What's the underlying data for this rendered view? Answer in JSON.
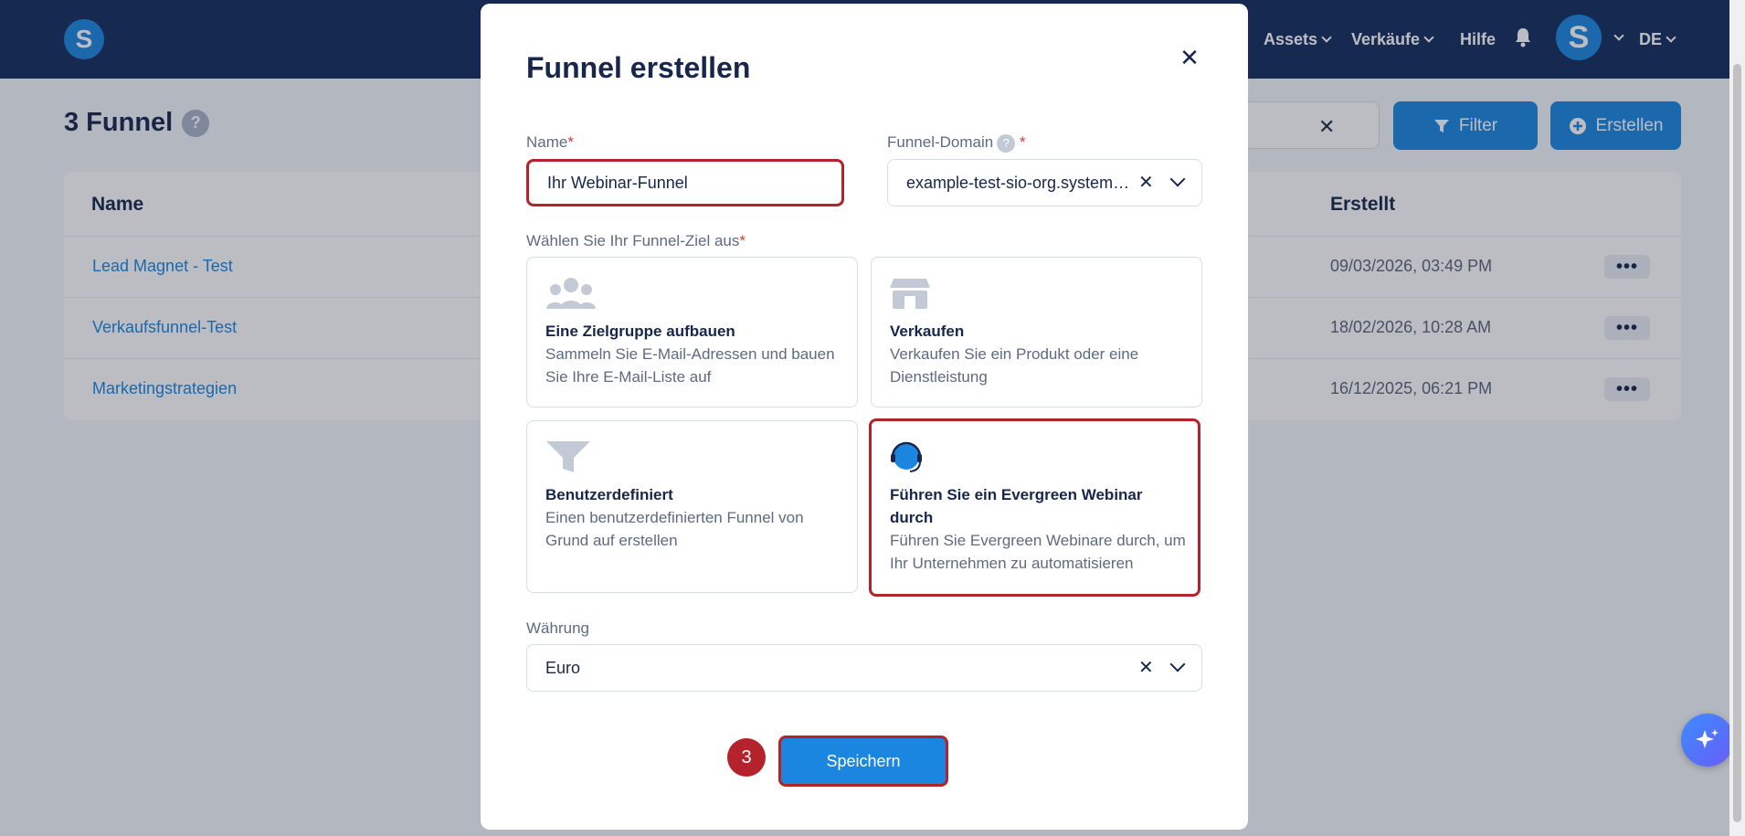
{
  "topbar": {
    "nav": [
      {
        "label": "Assets"
      },
      {
        "label": "Verkäufe"
      },
      {
        "label": "Hilfe"
      }
    ],
    "avatar_letter": "S",
    "logo_letter": "S",
    "language": "DE"
  },
  "page": {
    "title": "3 Funnel",
    "help_icon": "?",
    "filter_label": "Filter",
    "create_label": "Erstellen"
  },
  "table": {
    "headers": {
      "name": "Name",
      "created": "Erstellt"
    },
    "rows": [
      {
        "name": "Lead Magnet - Test",
        "created": "09/03/2026, 03:49 PM"
      },
      {
        "name": "Verkaufsfunnel-Test",
        "created": "18/02/2026, 10:28 AM"
      },
      {
        "name": "Marketingstrategien",
        "created": "16/12/2025, 06:21 PM"
      }
    ],
    "row_menu": "•••"
  },
  "modal": {
    "title": "Funnel erstellen",
    "close": "✕",
    "name_label": "Name",
    "name_value": "Ihr Webinar-Funnel",
    "required_mark": "*",
    "domain_label": "Funnel-Domain",
    "domain_value": "example-test-sio-org.system…",
    "goal_label": "Wählen Sie Ihr Funnel-Ziel aus",
    "goals": [
      {
        "title": "Eine Zielgruppe aufbauen",
        "desc": "Sammeln Sie E-Mail-Adressen und bauen Sie Ihre E-Mail-Liste auf",
        "icon": "people-icon"
      },
      {
        "title": "Verkaufen",
        "desc": "Verkaufen Sie ein Produkt oder eine Dienstleistung",
        "icon": "shop-icon"
      },
      {
        "title": "Benutzerdefiniert",
        "desc": "Einen benutzerdefinierten Funnel von Grund auf erstellen",
        "icon": "funnel-icon"
      },
      {
        "title": "Führen Sie ein Evergreen Webinar durch",
        "desc": "Führen Sie Evergreen Webinare durch, um Ihr Unternehmen zu automatisieren",
        "icon": "headset-icon"
      }
    ],
    "currency_label": "Währung",
    "currency_value": "Euro",
    "save_label": "Speichern",
    "step_number": "3"
  },
  "colors": {
    "brand_blue": "#1a86e0",
    "topbar_navy": "#142b5c",
    "highlight_red": "#b4232b"
  }
}
